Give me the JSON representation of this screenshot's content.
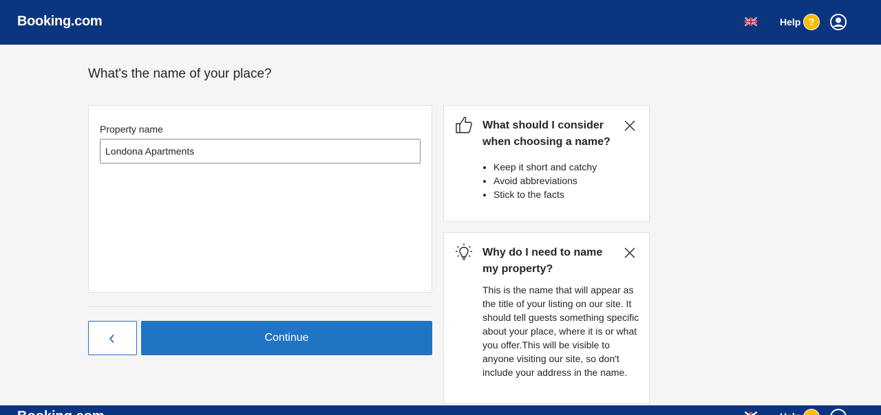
{
  "header": {
    "logo": "Booking.com",
    "help_label": "Help",
    "help_icon_glyph": "?",
    "language_icon": "uk-flag-icon",
    "user_icon": "user-icon"
  },
  "page": {
    "title": "What's the name of your place?"
  },
  "form": {
    "property_name_label": "Property name",
    "property_name_value": "Londona Apartments"
  },
  "actions": {
    "back_icon": "chevron-left-icon",
    "continue_label": "Continue"
  },
  "tips": [
    {
      "icon": "thumbs-up-icon",
      "title": "What should I consider when choosing a name?",
      "items": [
        "Keep it short and catchy",
        "Avoid abbreviations",
        "Stick to the facts"
      ]
    },
    {
      "icon": "lightbulb-icon",
      "title": "Why do I need to name my property?",
      "body": "This is the name that will appear as the title of your listing on our site. It should tell guests something specific about your place, where it is or what you offer.This will be visible to anyone visiting our site, so don't include your address in the name."
    }
  ],
  "colors": {
    "brand_navy": "#0c3580",
    "primary_blue": "#2074c4",
    "help_yellow": "#febb02",
    "page_background": "#f5f5f5"
  }
}
